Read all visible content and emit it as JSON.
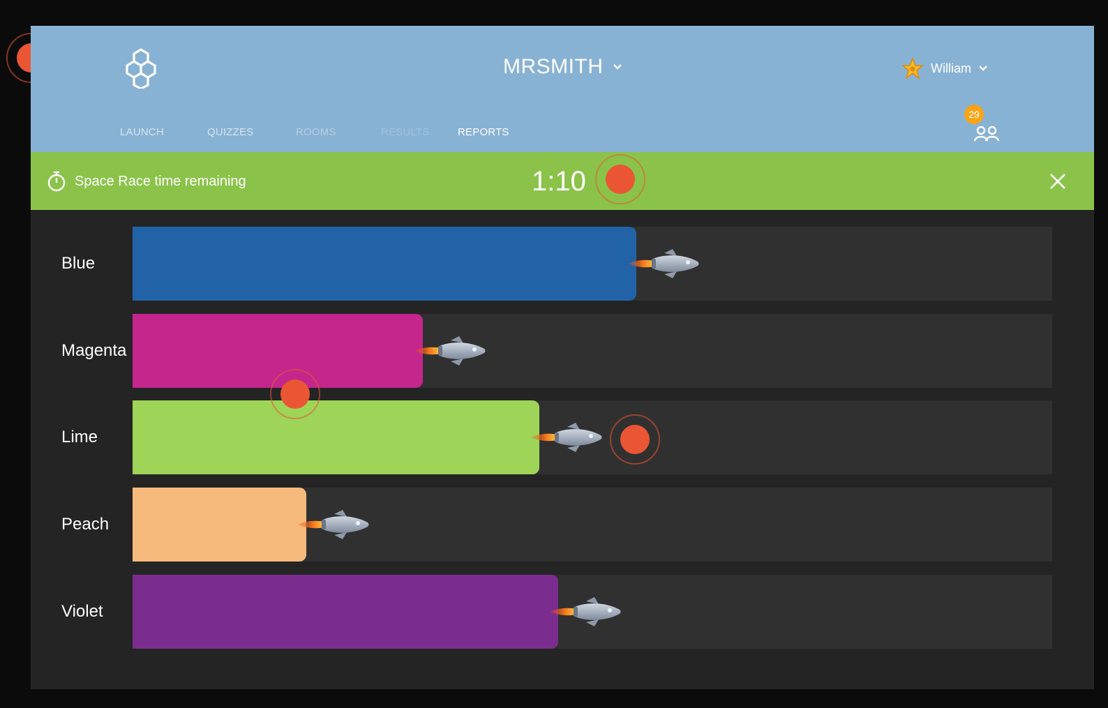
{
  "header": {
    "room_name": "MRSMITH",
    "user_name": "William",
    "student_count": "29",
    "nav": [
      "LAUNCH",
      "QUIZZES",
      "ROOMS",
      "RESULTS",
      "REPORTS"
    ]
  },
  "timer": {
    "label": "Space Race time remaining",
    "value": "1:10"
  },
  "teams": [
    {
      "name": "Blue",
      "color": "#2263a8",
      "progress": 0.548
    },
    {
      "name": "Magenta",
      "color": "#c4268c",
      "progress": 0.316
    },
    {
      "name": "Lime",
      "color": "#9ed457",
      "progress": 0.442
    },
    {
      "name": "Peach",
      "color": "#f6ba7c",
      "progress": 0.189
    },
    {
      "name": "Violet",
      "color": "#7b2d8f",
      "progress": 0.463
    }
  ],
  "colors": {
    "header_bg": "#88b2d4",
    "timer_bg": "#8bc34a",
    "track_bg": "#303030",
    "badge": "#f7a416",
    "marker": "#ea5634"
  }
}
